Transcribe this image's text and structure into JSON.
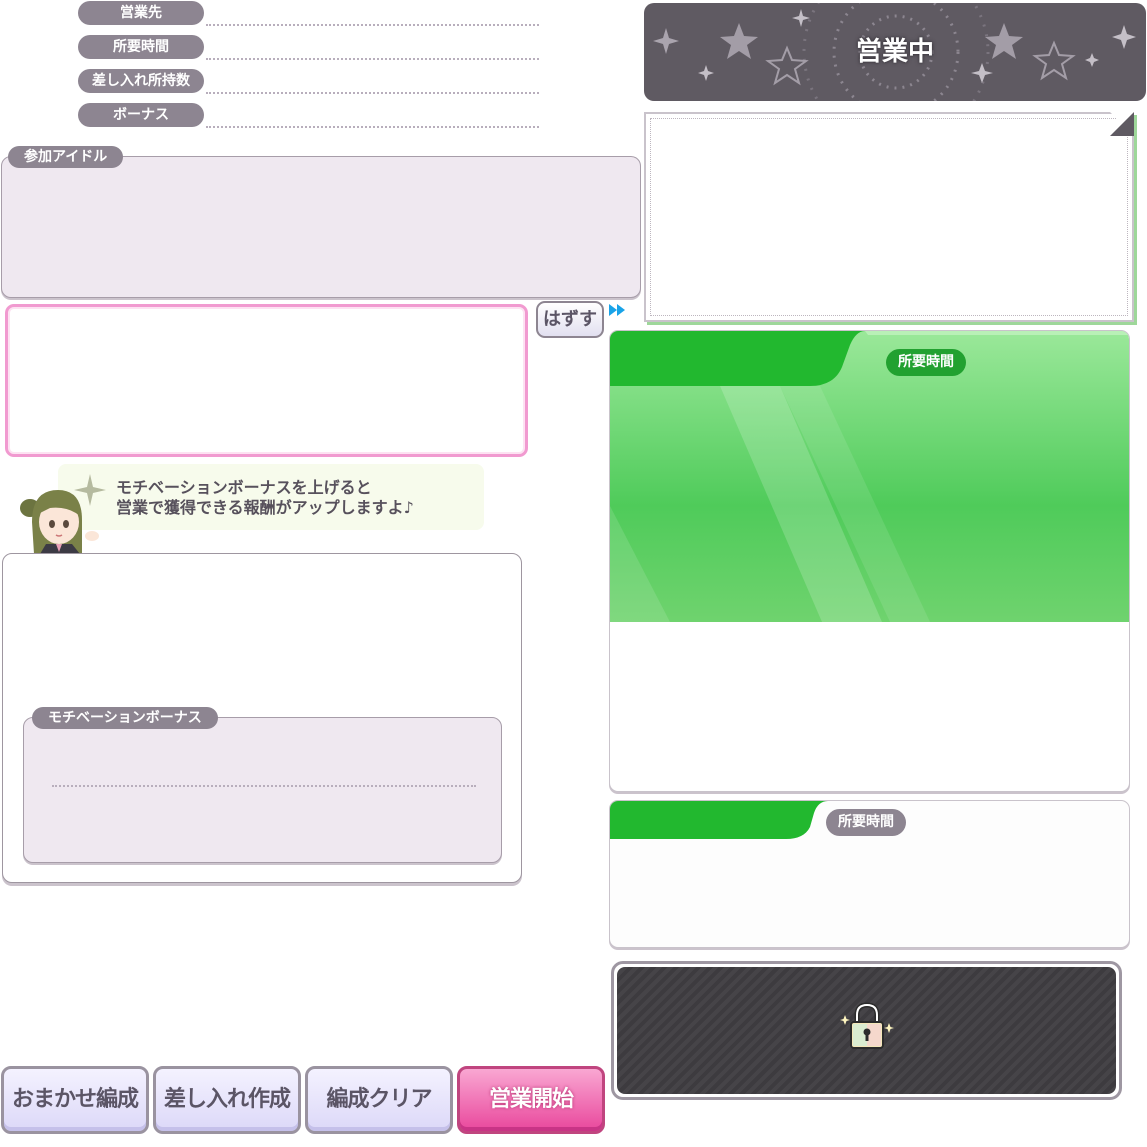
{
  "info_rows": [
    {
      "label": "営業先"
    },
    {
      "label": "所要時間"
    },
    {
      "label": "差し入れ所持数"
    },
    {
      "label": "ボーナス"
    }
  ],
  "status_banner": {
    "label": "営業中"
  },
  "participants": {
    "label": "参加アイドル"
  },
  "remove_button": {
    "label": "はずす"
  },
  "hint": {
    "line1": "モチベーションボーナスを上げると",
    "line2": "営業で獲得できる報酬がアップしますよ♪"
  },
  "motivation": {
    "label": "モチベーションボーナス"
  },
  "green_card": {
    "badge": "所要時間"
  },
  "small_card": {
    "badge": "所要時間"
  },
  "locked_slot": {
    "icon": "lock-icon"
  },
  "buttons": {
    "auto": "おまかせ編成",
    "gift": "差し入れ作成",
    "clear": "編成クリア",
    "start": "営業開始"
  },
  "colors": {
    "accent_green": "#2bbf3b",
    "accent_pink": "#e9479c",
    "pill_gray": "#8d8591",
    "locked_bg": "#3d3b3f"
  }
}
